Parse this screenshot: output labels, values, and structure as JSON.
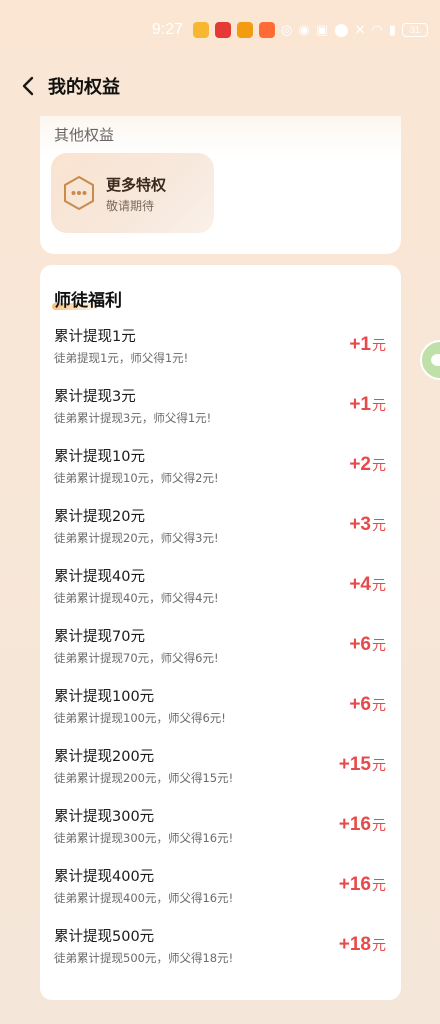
{
  "status_bar": {
    "time": "9:27",
    "battery": "31",
    "app_badges": [
      {
        "name": "game-badge-icon",
        "color": "#f7b731"
      },
      {
        "name": "shop-badge-icon",
        "color": "#e53935"
      },
      {
        "name": "star-badge-icon",
        "color": "#f39c12"
      },
      {
        "name": "sale-badge-icon",
        "color": "#ff6b35"
      }
    ]
  },
  "nav": {
    "title": "我的权益"
  },
  "other_perks": {
    "title": "其他权益",
    "tile": {
      "name": "更多特权",
      "subtitle": "敬请期待"
    }
  },
  "welfare": {
    "title": "师徒福利",
    "amount_color": "#e84a4a",
    "rows": [
      {
        "title": "累计提现1元",
        "desc": "徒弟提现1元，师父得1元!",
        "amount": "+1",
        "unit": "元"
      },
      {
        "title": "累计提现3元",
        "desc": "徒弟累计提现3元，师父得1元!",
        "amount": "+1",
        "unit": "元"
      },
      {
        "title": "累计提现10元",
        "desc": "徒弟累计提现10元，师父得2元!",
        "amount": "+2",
        "unit": "元"
      },
      {
        "title": "累计提现20元",
        "desc": "徒弟累计提现20元，师父得3元!",
        "amount": "+3",
        "unit": "元"
      },
      {
        "title": "累计提现40元",
        "desc": "徒弟累计提现40元，师父得4元!",
        "amount": "+4",
        "unit": "元"
      },
      {
        "title": "累计提现70元",
        "desc": "徒弟累计提现70元，师父得6元!",
        "amount": "+6",
        "unit": "元"
      },
      {
        "title": "累计提现100元",
        "desc": "徒弟累计提现100元，师父得6元!",
        "amount": "+6",
        "unit": "元"
      },
      {
        "title": "累计提现200元",
        "desc": "徒弟累计提现200元，师父得15元!",
        "amount": "+15",
        "unit": "元"
      },
      {
        "title": "累计提现300元",
        "desc": "徒弟累计提现300元，师父得16元!",
        "amount": "+16",
        "unit": "元"
      },
      {
        "title": "累计提现400元",
        "desc": "徒弟累计提现400元，师父得16元!",
        "amount": "+16",
        "unit": "元"
      },
      {
        "title": "累计提现500元",
        "desc": "徒弟累计提现500元，师父得18元!",
        "amount": "+18",
        "unit": "元"
      }
    ]
  }
}
